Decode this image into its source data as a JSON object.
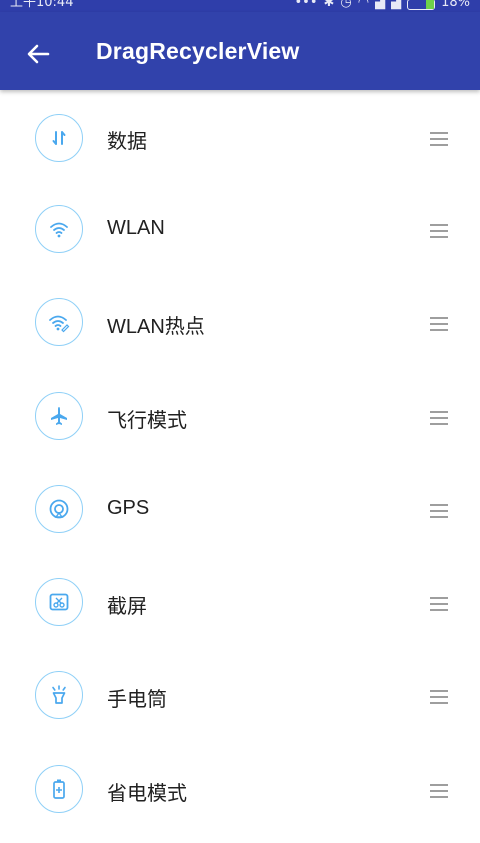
{
  "status_bar": {
    "time": "上午10:44",
    "battery": "18%"
  },
  "app_bar": {
    "title": "DragRecyclerView"
  },
  "list": {
    "items": [
      {
        "label": "数据",
        "icon": "data-transfer-icon"
      },
      {
        "label": "WLAN",
        "icon": "wifi-icon"
      },
      {
        "label": "WLAN热点",
        "icon": "wifi-hotspot-icon"
      },
      {
        "label": "飞行模式",
        "icon": "airplane-icon"
      },
      {
        "label": "GPS",
        "icon": "gps-icon"
      },
      {
        "label": "截屏",
        "icon": "screenshot-icon"
      },
      {
        "label": "手电筒",
        "icon": "flashlight-icon"
      },
      {
        "label": "省电模式",
        "icon": "battery-saver-icon"
      }
    ]
  },
  "colors": {
    "primary": "#3142ab",
    "icon_accent": "#4aa8ee",
    "handle": "#9e9e9e"
  }
}
